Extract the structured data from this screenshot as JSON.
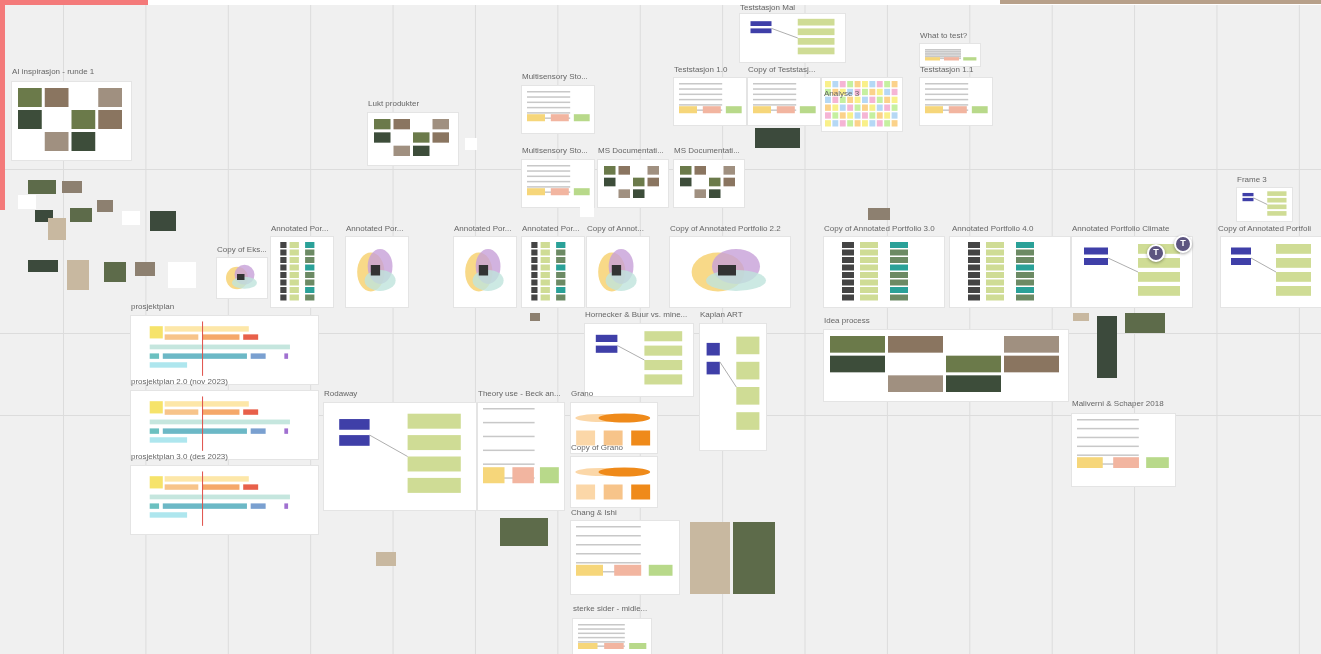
{
  "frames": [
    {
      "title": "AI inspirasjon - runde 1",
      "kind": "photos"
    },
    {
      "title": "Lukt produkter",
      "kind": "photos"
    },
    {
      "title": "Multisensory Sto...",
      "kind": "doc"
    },
    {
      "title": "Multisensory Sto...",
      "kind": "doc"
    },
    {
      "title": "MS Documentati...",
      "kind": "photos"
    },
    {
      "title": "MS Documentati...",
      "kind": "photos"
    },
    {
      "title": "Teststasjon Mal",
      "kind": "diagram"
    },
    {
      "title": "Teststasjon 1.0",
      "kind": "doc"
    },
    {
      "title": "Copy of Teststasj...",
      "kind": "doc"
    },
    {
      "title": "Analyse 3",
      "kind": "stickies"
    },
    {
      "title": "What to test?",
      "kind": "doc"
    },
    {
      "title": "Teststasjon 1.1",
      "kind": "doc"
    },
    {
      "title": "Frame 3",
      "kind": "diagram"
    },
    {
      "title": "Copy of Eks...",
      "kind": "venn"
    },
    {
      "title": "Annotated Por...",
      "kind": "portfolio"
    },
    {
      "title": "Annotated Por...",
      "kind": "venn"
    },
    {
      "title": "Annotated Por...",
      "kind": "venn"
    },
    {
      "title": "Annotated Por...",
      "kind": "portfolio"
    },
    {
      "title": "Copy of Annot...",
      "kind": "venn"
    },
    {
      "title": "Copy of Annotated Portfolio 2.2",
      "kind": "venn"
    },
    {
      "title": "Copy of Annotated Portfolio 3.0",
      "kind": "portfolio"
    },
    {
      "title": "Annotated Portfolio 4.0",
      "kind": "portfolio"
    },
    {
      "title": "Annotated Portfolio Climate",
      "kind": "diagram"
    },
    {
      "title": "Copy of Annotated Portfoli",
      "kind": "diagram"
    },
    {
      "title": "prosjektplan",
      "kind": "timeline"
    },
    {
      "title": "prosjektplan 2.0 (nov 2023)",
      "kind": "timeline"
    },
    {
      "title": "prosjektplan 3.0 (des 2023)",
      "kind": "timeline"
    },
    {
      "title": "Rodaway",
      "kind": "diagram"
    },
    {
      "title": "Theory use - Beck an...",
      "kind": "doc"
    },
    {
      "title": "Hornecker & Buur vs. mine...",
      "kind": "diagram"
    },
    {
      "title": "Kaplan ART",
      "kind": "diagram"
    },
    {
      "title": "Grano",
      "kind": "clouds"
    },
    {
      "title": "Copy of Grano",
      "kind": "clouds"
    },
    {
      "title": "Chang & Ishi",
      "kind": "doc"
    },
    {
      "title": "sterke sider - midle...",
      "kind": "doc"
    },
    {
      "title": "Idea process",
      "kind": "photos"
    },
    {
      "title": "Maliverni & Schaper 2018",
      "kind": "doc"
    }
  ],
  "collaborators": [
    {
      "initial": "T"
    },
    {
      "initial": "T"
    }
  ]
}
